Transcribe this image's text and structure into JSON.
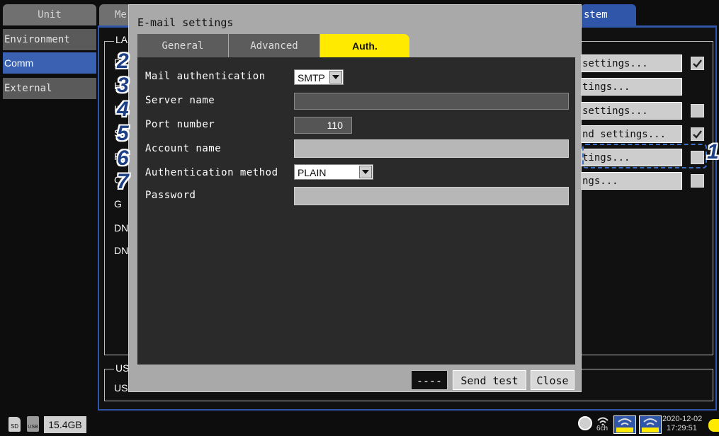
{
  "top_tabs": {
    "unit": "Unit",
    "measure_partial": "Me",
    "system_partial": "stem"
  },
  "sidebar": {
    "items": [
      {
        "label": "Environment"
      },
      {
        "label": "Comm"
      },
      {
        "label": "External"
      }
    ]
  },
  "background": {
    "lan_group_partial": "LA",
    "usb_group_partial": "US",
    "usb_row_partial": "US",
    "left_letters": [
      "D",
      "H",
      "IP",
      "S",
      "P",
      "C",
      "G",
      "DN",
      "DN"
    ],
    "right_buttons": [
      {
        "label": "settings...",
        "checked": true
      },
      {
        "label": "tings...",
        "checked": null
      },
      {
        "label": " settings...",
        "checked": false
      },
      {
        "label": "nd settings...",
        "checked": true
      },
      {
        "label": "tings...",
        "checked": false
      },
      {
        "label": "ngs...",
        "checked": false
      }
    ]
  },
  "dialog": {
    "title": "E-mail settings",
    "tabs": [
      {
        "label": "General"
      },
      {
        "label": "Advanced"
      },
      {
        "label": "Auth."
      }
    ],
    "active_tab": "Auth.",
    "rows": {
      "mail_auth": {
        "label": "Mail authentication",
        "value": "SMTP"
      },
      "server_name": {
        "label": "Server name",
        "value": ""
      },
      "port_number": {
        "label": "Port number",
        "value": "110"
      },
      "account_name": {
        "label": "Account name",
        "value": ""
      },
      "auth_method": {
        "label": "Authentication method",
        "value": "PLAIN"
      },
      "password": {
        "label": "Password",
        "value": ""
      }
    },
    "status_box": "----",
    "send_test": "Send test",
    "close": "Close"
  },
  "callouts": [
    "1",
    "2",
    "3",
    "4",
    "5",
    "6",
    "7"
  ],
  "statusbar": {
    "storage": "15.4GB",
    "channels": "6ch",
    "date": "2020-12-02",
    "time": "17:29:51"
  },
  "colors": {
    "accent_blue": "#2f56a8",
    "active_tab_yellow": "#ffea00",
    "callout_blue": "#1c3f86"
  }
}
